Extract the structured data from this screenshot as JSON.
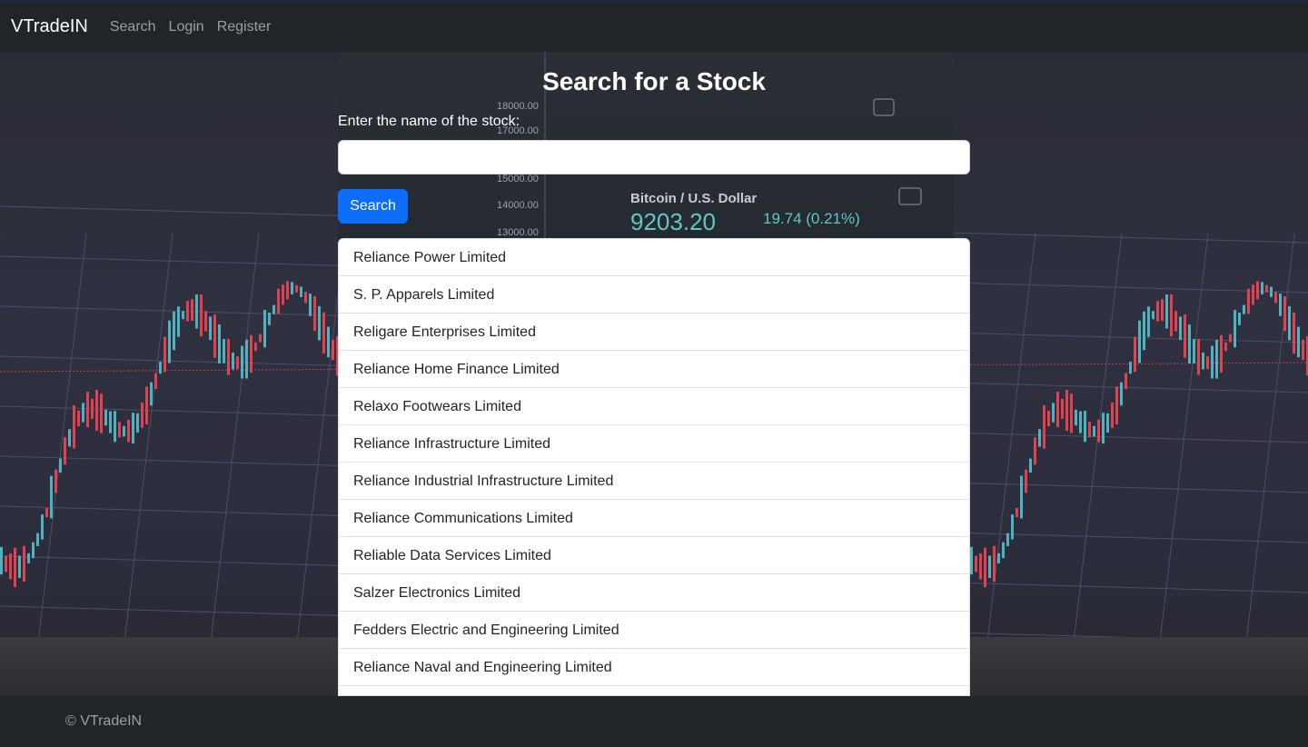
{
  "navbar": {
    "brand": "VTradeIN",
    "links": [
      "Search",
      "Login",
      "Register"
    ]
  },
  "main": {
    "title": "Search for a Stock",
    "input_label": "Enter the name of the stock:",
    "input_value": "",
    "input_placeholder": "",
    "search_button_label": "Search",
    "results": [
      "Reliance Power Limited",
      "S. P. Apparels Limited",
      "Religare Enterprises Limited",
      "Reliance Home Finance Limited",
      "Relaxo Footwears Limited",
      "Reliance Infrastructure Limited",
      "Reliance Industrial Infrastructure Limited",
      "Reliance Communications Limited",
      "Reliable Data Services Limited",
      "Salzer Electronics Limited",
      "Fedders Electric and Engineering Limited",
      "Reliance Naval and Engineering Limited"
    ]
  },
  "background": {
    "ticker_text": "Bitcoin / U.S. Dollar",
    "price": "9203.20",
    "change": "19.74 (0.21%)",
    "price_levels": [
      "18000.00",
      "17000.00",
      "15000.00",
      "14000.00",
      "13000.00"
    ]
  },
  "footer": {
    "text": "© VTradeIN"
  },
  "colors": {
    "navbar_bg": "#212529",
    "primary": "#0d6efd",
    "candle_up": "#4fb3bf",
    "candle_down": "#e0434f"
  }
}
